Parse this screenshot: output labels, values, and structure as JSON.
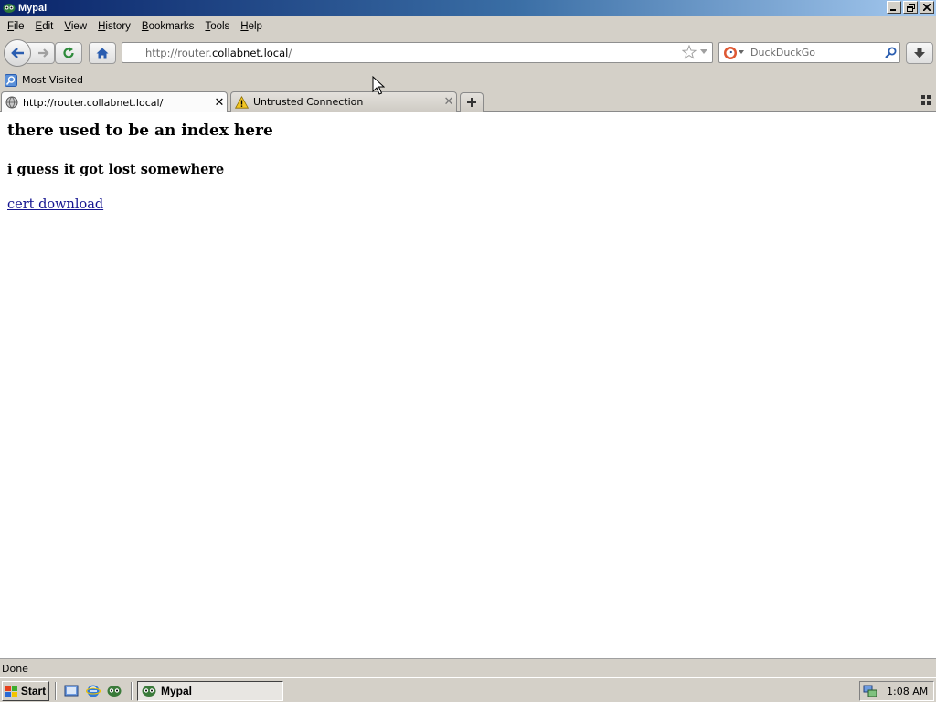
{
  "window": {
    "title": "Mypal"
  },
  "menu": [
    "File",
    "Edit",
    "View",
    "History",
    "Bookmarks",
    "Tools",
    "Help"
  ],
  "menu_mnemonic_index": [
    0,
    0,
    0,
    0,
    0,
    0,
    0
  ],
  "nav": {
    "url_scheme": "http://router.",
    "url_host": "collabnet.local",
    "url_tail": "/",
    "search_placeholder": "DuckDuckGo"
  },
  "bookmarks": {
    "most_visited": "Most Visited"
  },
  "tabs": [
    {
      "label": "http://router.collabnet.local/",
      "active": true,
      "icon": "globe-icon"
    },
    {
      "label": "Untrusted Connection",
      "active": false,
      "icon": "warning-icon"
    }
  ],
  "page": {
    "heading": "there used to be an index here",
    "subheading": "i guess it got lost somewhere",
    "link": "cert download"
  },
  "status": {
    "text": "Done"
  },
  "taskbar": {
    "start": "Start",
    "task": "Mypal",
    "clock": "1:08 AM"
  },
  "colors": {
    "titlebar_start": "#0a246a",
    "titlebar_end": "#a6caf0",
    "chrome": "#d4d0c8",
    "link": "#141490"
  }
}
